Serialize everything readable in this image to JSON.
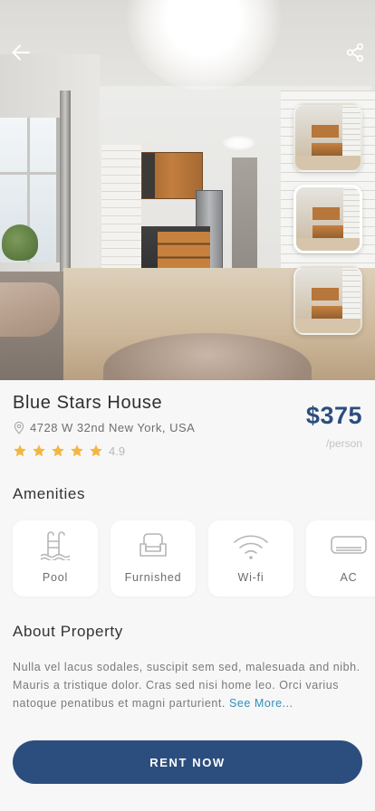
{
  "property": {
    "name": "Blue Stars House",
    "address": "4728 W 32nd New York, USA",
    "rating": "4.9",
    "rating_stars": 5,
    "price": "$375",
    "price_unit": "/person"
  },
  "gallery": {
    "thumbnail_count": 3,
    "active_index": 1
  },
  "amenities": {
    "title": "Amenities",
    "items": [
      {
        "label": "Pool",
        "icon": "pool-icon"
      },
      {
        "label": "Furnished",
        "icon": "armchair-icon"
      },
      {
        "label": "Wi-fi",
        "icon": "wifi-icon"
      },
      {
        "label": "AC",
        "icon": "air-conditioner-icon"
      }
    ]
  },
  "about": {
    "title": "About Property",
    "text": "Nulla vel lacus sodales, suscipit sem sed, malesuada and nibh. Mauris a tristique dolor. Cras sed nisi home leo. Orci varius natoque penatibus et magni parturient.",
    "see_more": "See More..."
  },
  "cta": {
    "label": "RENT NOW"
  },
  "colors": {
    "primary": "#2b4e7e",
    "star": "#f4b63f",
    "link": "#2f8fbc"
  }
}
